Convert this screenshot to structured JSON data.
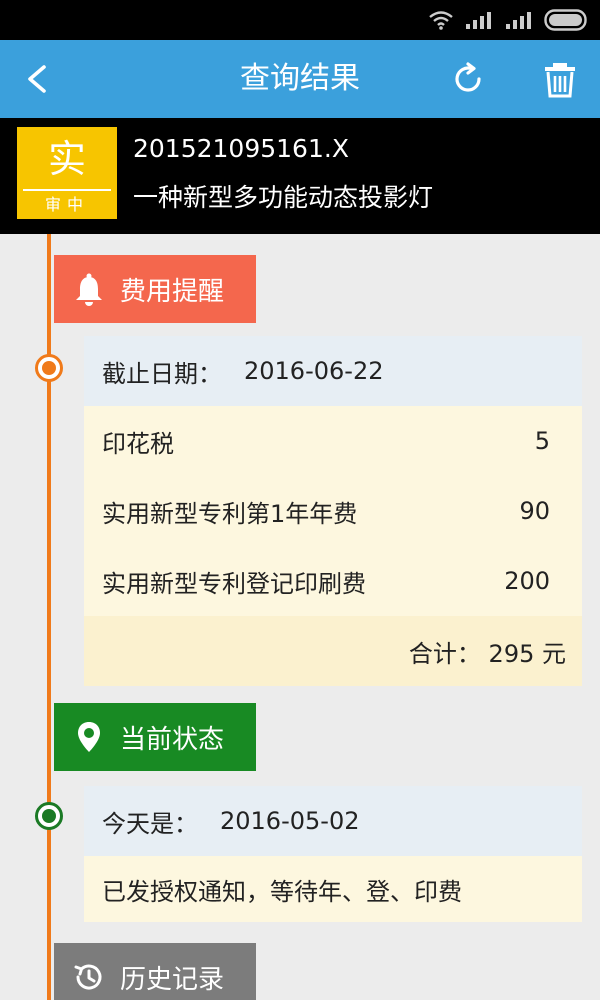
{
  "appbar": {
    "title": "查询结果",
    "back_icon": "arrow-left-icon",
    "refresh_icon": "refresh-icon",
    "delete_icon": "trash-icon",
    "color": "#3ba0dc"
  },
  "patent": {
    "badge_main": "实",
    "badge_sub": "审中",
    "number": "201521095161.X",
    "name": "一种新型多功能动态投影灯",
    "badge_color": "#f7c500"
  },
  "fee_section": {
    "label": "费用提醒",
    "icon": "bell-icon",
    "color": "#f4674d",
    "deadline_label": "截止日期：",
    "deadline_value": "2016-06-22",
    "items": [
      {
        "name": "印花税",
        "amount": "5"
      },
      {
        "name": "实用新型专利第1年年费",
        "amount": "90"
      },
      {
        "name": "实用新型专利登记印刷费",
        "amount": "200"
      }
    ],
    "total_text": "合计： 295 元"
  },
  "status_section": {
    "label": "当前状态",
    "icon": "location-pin-icon",
    "color": "#188a23",
    "today_label": "今天是：",
    "today_value": "2016-05-02",
    "status_text": "已发授权通知，等待年、登、印费"
  },
  "history_section": {
    "label": "历史记录",
    "icon": "history-clock-icon",
    "color": "#7c7c7c"
  }
}
